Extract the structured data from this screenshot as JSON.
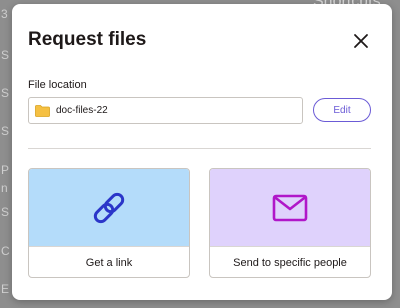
{
  "background": {
    "title_fragment": "Shortcuts",
    "side_letters": [
      "3",
      "S",
      "S",
      "S",
      "P",
      "n",
      "S",
      "C",
      "E"
    ]
  },
  "dialog": {
    "title": "Request files",
    "close_icon": "close-icon",
    "file_location": {
      "label": "File location",
      "value": "doc-files-22",
      "folder_icon": "folder-icon",
      "edit_label": "Edit"
    },
    "options": [
      {
        "label": "Get a link",
        "icon": "link-icon",
        "color": "#b4dcfa"
      },
      {
        "label": "Send to specific people",
        "icon": "mail-icon",
        "color": "#dfd2fc"
      }
    ]
  },
  "colors": {
    "accent": "#6b5bd6",
    "icon_link": "#2b36c9",
    "icon_mail": "#b017c9",
    "folder": "#f5c042"
  }
}
